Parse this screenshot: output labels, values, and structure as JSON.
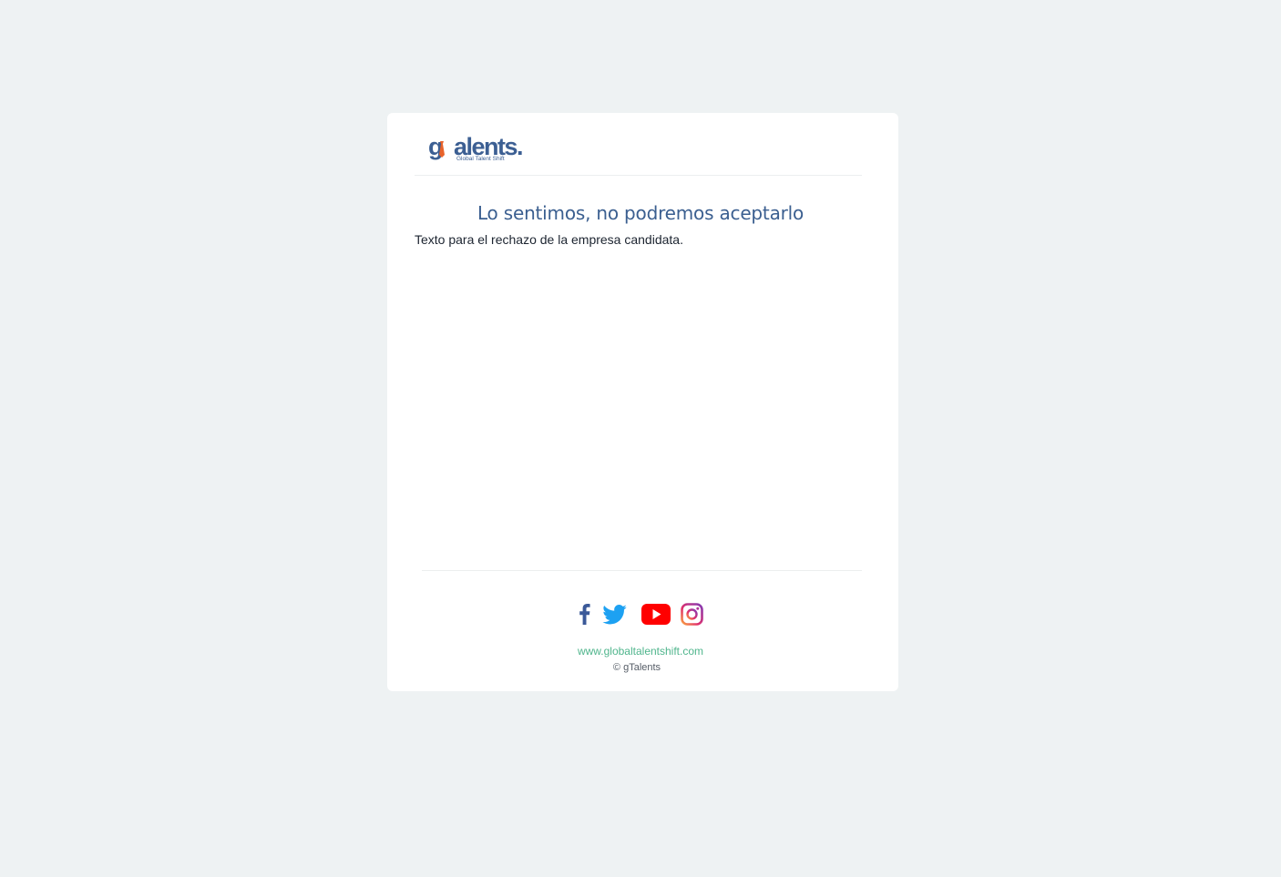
{
  "brand": {
    "logo_text": "gTalents",
    "logo_tagline": "Global Talent Shift",
    "primary_color": "#3c5f93",
    "accent_color": "#e8632b"
  },
  "message": {
    "title": "Lo sentimos, no podremos aceptarlo",
    "body": "Texto para el rechazo de la empresa candidata."
  },
  "footer": {
    "social_icons": [
      "facebook-icon",
      "twitter-icon",
      "youtube-icon",
      "instagram-icon"
    ],
    "website": "www.globaltalentshift.com",
    "copyright": "© gTalents",
    "link_color": "#4fb58c"
  },
  "page": {
    "background": "#eef2f3"
  }
}
